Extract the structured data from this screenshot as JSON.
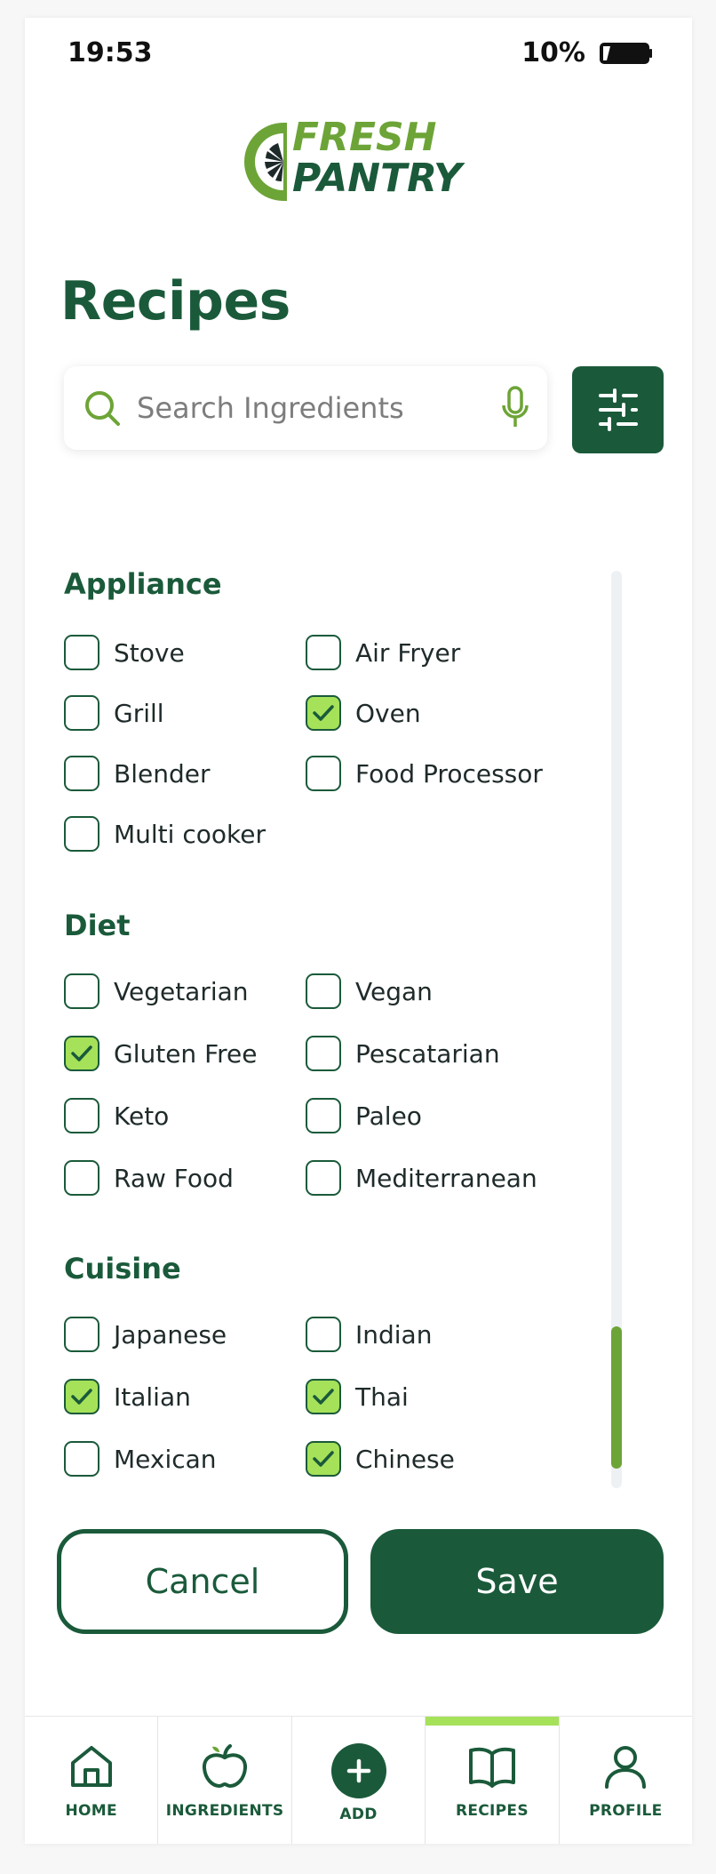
{
  "status": {
    "time": "19:53",
    "battery": "10%"
  },
  "brand": {
    "line1": "FRESH",
    "line2": "PANTRY",
    "dark": "#1a5a3a",
    "light": "#6da437",
    "accent": "#a6e15a"
  },
  "page": {
    "title": "Recipes"
  },
  "search": {
    "placeholder": "Search Ingredients"
  },
  "sections": {
    "appliance": {
      "title": "Appliance",
      "options": [
        {
          "label": "Stove",
          "checked": false
        },
        {
          "label": "Air Fryer",
          "checked": false
        },
        {
          "label": "Grill",
          "checked": false
        },
        {
          "label": "Oven",
          "checked": true
        },
        {
          "label": "Blender",
          "checked": false
        },
        {
          "label": "Food Processor",
          "checked": false
        },
        {
          "label": "Multi cooker",
          "checked": false
        }
      ]
    },
    "diet": {
      "title": "Diet",
      "options": [
        {
          "label": "Vegetarian",
          "checked": false
        },
        {
          "label": "Vegan",
          "checked": false
        },
        {
          "label": "Gluten Free",
          "checked": true
        },
        {
          "label": "Pescatarian",
          "checked": false
        },
        {
          "label": "Keto",
          "checked": false
        },
        {
          "label": "Paleo",
          "checked": false
        },
        {
          "label": "Raw Food",
          "checked": false
        },
        {
          "label": "Mediterranean",
          "checked": false
        }
      ]
    },
    "cuisine": {
      "title": "Cuisine",
      "options": [
        {
          "label": "Japanese",
          "checked": false
        },
        {
          "label": "Indian",
          "checked": false
        },
        {
          "label": "Italian",
          "checked": true
        },
        {
          "label": "Thai",
          "checked": true
        },
        {
          "label": "Mexican",
          "checked": false
        },
        {
          "label": "Chinese",
          "checked": true
        }
      ]
    }
  },
  "actions": {
    "cancel": "Cancel",
    "save": "Save"
  },
  "tabs": [
    {
      "label": "HOME",
      "icon": "home-icon",
      "active": false
    },
    {
      "label": "INGREDIENTS",
      "icon": "apple-icon",
      "active": false
    },
    {
      "label": "ADD",
      "icon": "plus-icon",
      "active": false
    },
    {
      "label": "RECIPES",
      "icon": "book-icon",
      "active": true
    },
    {
      "label": "PROFILE",
      "icon": "user-icon",
      "active": false
    }
  ]
}
